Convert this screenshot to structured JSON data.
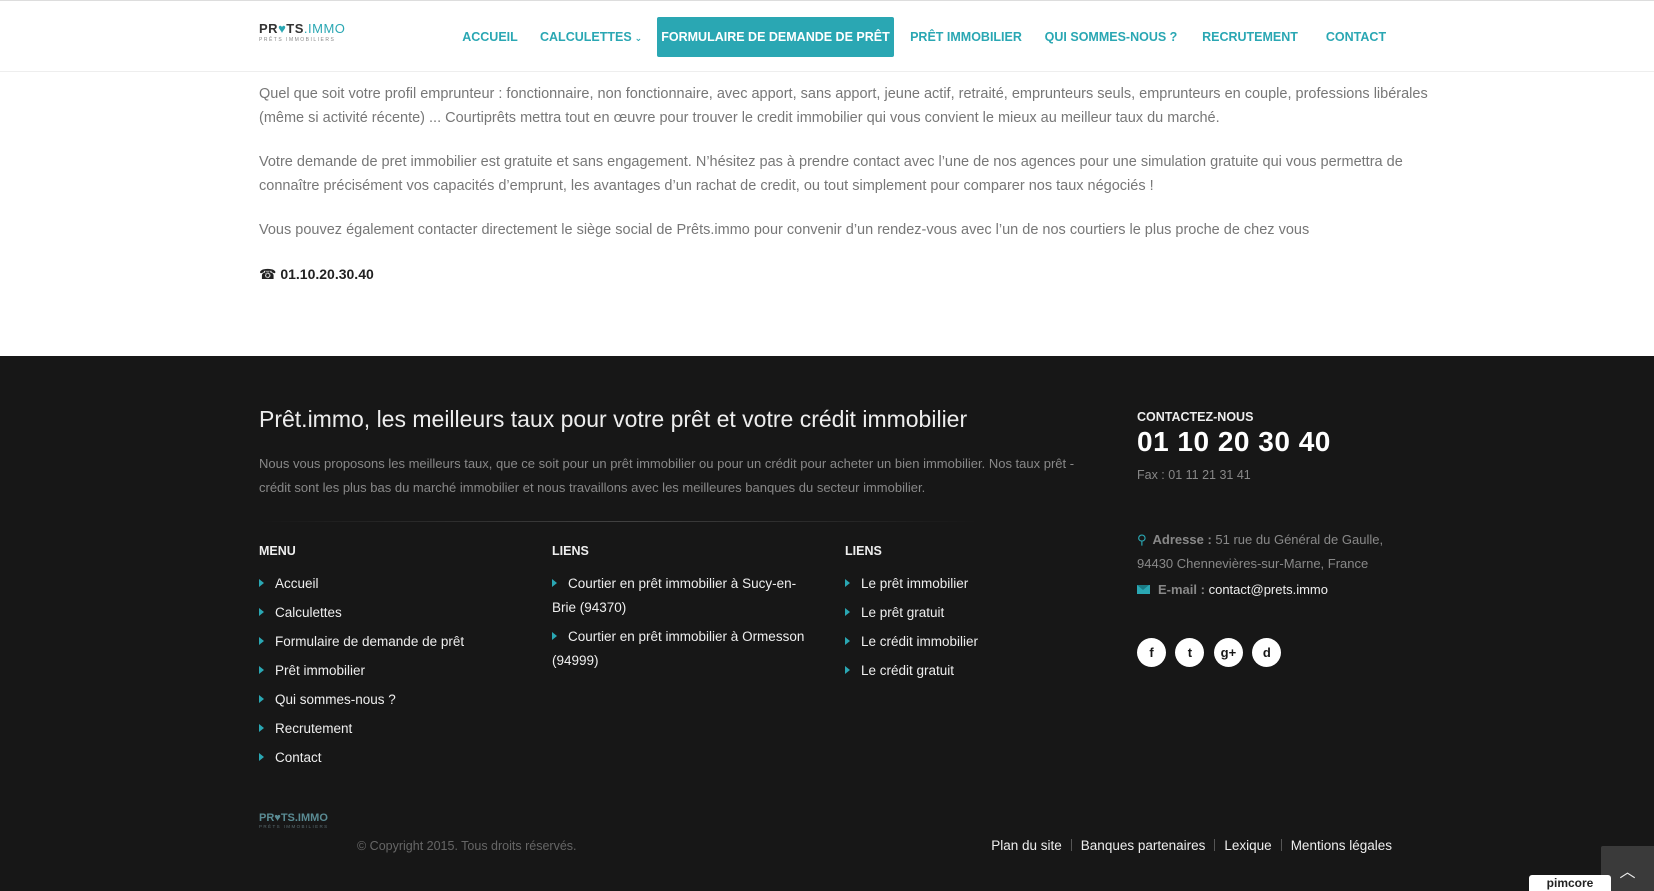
{
  "header": {
    "logo": {
      "text_a": "PR",
      "text_b": "TS",
      "text_c": ".IMMO",
      "subtitle": "PRÊTS IMMOBILIERS"
    },
    "nav": [
      {
        "label": "ACCUEIL"
      },
      {
        "label": "CALCULETTES"
      },
      {
        "label": "FORMULAIRE DE DEMANDE DE PRÊT"
      },
      {
        "label": "PRÊT IMMOBILIER"
      },
      {
        "label": "QUI SOMMES-NOUS ?"
      },
      {
        "label": "RECRUTEMENT"
      },
      {
        "label": "CONTACT"
      }
    ]
  },
  "content": {
    "p1": "Quel que soit votre profil emprunteur : fonctionnaire, non fonctionnaire, avec apport, sans apport, jeune actif, retraité, emprunteurs seuls, emprunteurs en couple, professions libérales (même si activité récente) ... Courtiprêts mettra tout en œuvre pour trouver le credit immobilier qui vous convient le mieux au meilleur taux du marché.",
    "p2": "Votre demande de pret immobilier est gratuite et sans engagement. N’hésitez pas à prendre contact avec l’une de nos agences pour une simulation gratuite qui vous permettra de connaître précisément vos capacités d’emprunt, les avantages d’un rachat de credit, ou tout simplement pour comparer nos taux négociés !",
    "p3": "Vous pouvez également contacter directement le siège social de Prêts.immo pour convenir d’un rendez-vous avec l’un de nos courtiers le plus proche de chez vous",
    "phone": "01.10.20.30.40"
  },
  "footer": {
    "title": "Prêt.immo, les meilleurs taux pour votre prêt et votre crédit immobilier",
    "description": "Nous vous proposons les meilleurs taux, que ce soit pour un prêt immobilier ou pour un crédit pour acheter un bien immobilier. Nos taux prêt - crédit sont les plus bas du marché immobilier et nous travaillons avec les meilleures banques du secteur immobilier.",
    "menu": {
      "heading": "MENU",
      "items": [
        "Accueil",
        "Calculettes",
        "Formulaire de demande de prêt",
        "Prêt immobilier",
        "Qui sommes-nous ?",
        "Recrutement",
        "Contact"
      ]
    },
    "liens1": {
      "heading": "LIENS",
      "items": [
        "Courtier en prêt immobilier à Sucy-en-Brie (94370)",
        "Courtier en prêt immobilier à Ormesson (94999)"
      ]
    },
    "liens2": {
      "heading": "LIENS",
      "items": [
        "Le prêt immobilier",
        "Le prêt gratuit",
        "Le crédit immobilier",
        "Le crédit gratuit"
      ]
    },
    "contact": {
      "label": "CONTACTEZ-NOUS",
      "phone": "01 10 20 30 40",
      "fax": "Fax : 01 11 21 31 41",
      "address_label": "Adresse :",
      "address": "51 rue du Général de Gaulle, 94430 Chennevières-sur-Marne, France",
      "email_label": "E-mail :",
      "email": "contact@prets.immo"
    },
    "social": [
      "f",
      "t",
      "g+",
      "d"
    ],
    "copyright": "© Copyright 2015. Tous droits réservés.",
    "links": [
      "Plan du site",
      "Banques partenaires",
      "Lexique",
      "Mentions légales"
    ],
    "powered": "pimcore"
  },
  "colors": {
    "accent": "#2aa7b3",
    "footer_bg": "#171717"
  }
}
